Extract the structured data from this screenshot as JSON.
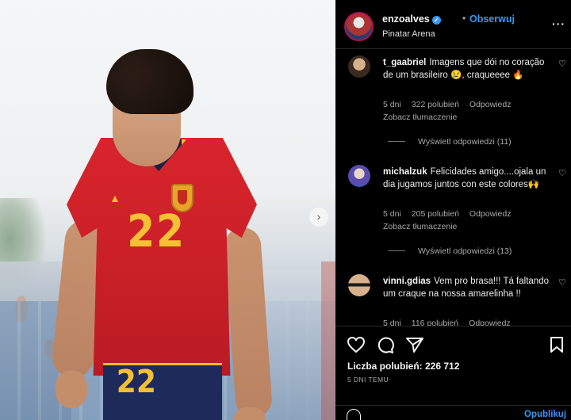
{
  "post": {
    "username": "enzoalves",
    "follow_label": "Obserwuj",
    "dot": "•",
    "location": "Pinatar Arena",
    "more": "···",
    "photo": {
      "shirt_number": "22",
      "shorts_number": "22",
      "maker_mark": "▲",
      "next_glyph": "›"
    }
  },
  "comments": [
    {
      "user": "t_gaabriel",
      "text": "Imagens que dói no coração de um brasileiro 😢, craqueeee 🔥",
      "time": "5 dni",
      "likes": "322 polubień",
      "reply": "Odpowiedz",
      "translate": "Zobacz tłumaczenie",
      "view_replies": "Wyświetl odpowiedzi (11)"
    },
    {
      "user": "michalzuk",
      "text": "Felicidades amigo....ojala un dia jugamos juntos con este colores🙌",
      "time": "5 dni",
      "likes": "205 polubień",
      "reply": "Odpowiedz",
      "translate": "Zobacz tłumaczenie",
      "view_replies": "Wyświetl odpowiedzi (13)"
    },
    {
      "user": "vinni.gdias",
      "text": "Vem pro brasa!!! Tá faltando um craque na nossa amarelinha !!",
      "time": "5 dni",
      "likes": "116 polubień",
      "reply": "Odpowiedz"
    }
  ],
  "actions": {
    "likes": "Liczba polubień: 226 712",
    "time_ago": "5 DNI TEMU"
  },
  "add_comment": {
    "placeholder": "",
    "publish": "Opublikuj"
  },
  "colors": {
    "accent": "#3897f0",
    "background": "#000000",
    "muted_text": "#a8a8a8"
  }
}
